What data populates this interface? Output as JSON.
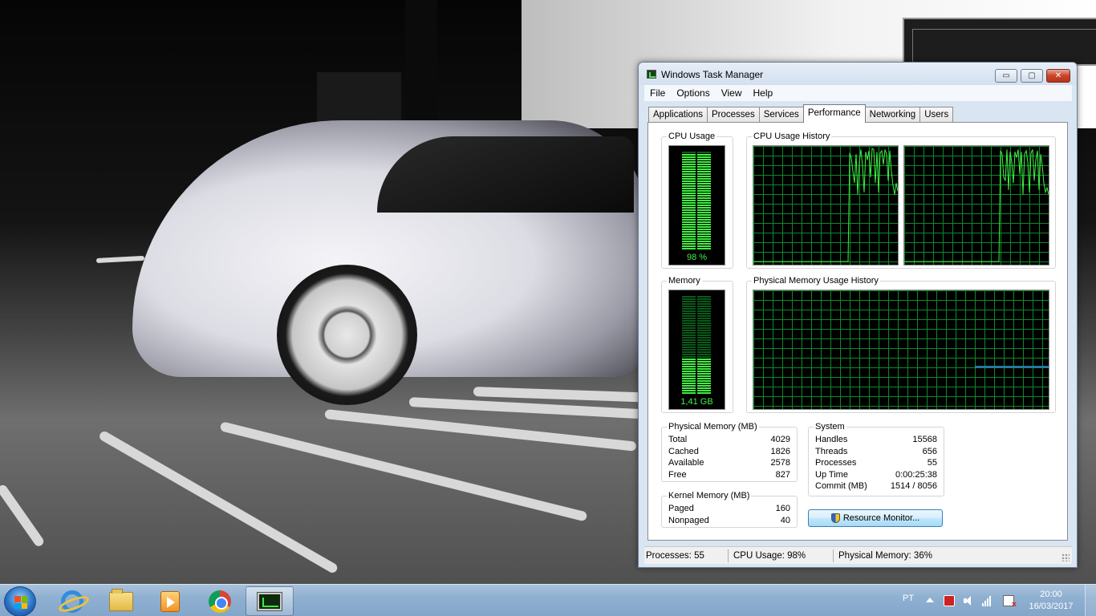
{
  "window": {
    "title": "Windows Task Manager",
    "controls": {
      "minimize": "▭",
      "maximize": "▢",
      "close": "✕"
    }
  },
  "menu": [
    "File",
    "Options",
    "View",
    "Help"
  ],
  "tabs": [
    {
      "label": "Applications",
      "active": false
    },
    {
      "label": "Processes",
      "active": false
    },
    {
      "label": "Services",
      "active": false
    },
    {
      "label": "Performance",
      "active": true
    },
    {
      "label": "Networking",
      "active": false
    },
    {
      "label": "Users",
      "active": false
    }
  ],
  "performance": {
    "cpu_usage": {
      "label": "CPU Usage",
      "value_text": "98 %",
      "percent": 98
    },
    "cpu_history": {
      "label": "CPU Usage History",
      "core1": [
        2,
        2,
        2,
        2,
        2,
        2,
        2,
        2,
        2,
        2,
        2,
        2,
        2,
        2,
        2,
        2,
        2,
        2,
        2,
        2,
        2,
        2,
        2,
        2,
        2,
        2,
        2,
        2,
        2,
        2,
        2,
        2,
        2,
        2,
        2,
        2,
        2,
        2,
        2,
        2,
        2,
        2,
        2,
        2,
        2,
        2,
        2,
        2,
        2,
        2,
        2,
        2,
        2,
        2,
        2,
        2,
        2,
        2,
        2,
        2,
        96,
        92,
        80,
        70,
        95,
        60,
        88,
        99,
        85,
        62,
        97,
        90,
        98,
        75,
        100,
        99,
        70,
        97,
        62,
        96,
        98,
        86,
        99,
        95,
        72,
        98,
        80,
        68,
        60,
        70,
        63
      ],
      "core2": [
        2,
        2,
        2,
        2,
        2,
        2,
        2,
        2,
        2,
        2,
        2,
        2,
        2,
        2,
        2,
        2,
        2,
        2,
        2,
        2,
        2,
        2,
        2,
        2,
        2,
        2,
        2,
        2,
        2,
        2,
        2,
        2,
        2,
        2,
        2,
        2,
        2,
        2,
        2,
        2,
        2,
        2,
        2,
        2,
        2,
        2,
        2,
        2,
        2,
        2,
        2,
        2,
        2,
        2,
        2,
        2,
        2,
        2,
        2,
        2,
        98,
        95,
        75,
        72,
        99,
        64,
        97,
        88,
        70,
        97,
        92,
        99,
        78,
        97,
        60,
        95,
        98,
        88,
        62,
        96,
        99,
        72,
        90,
        98,
        64,
        95,
        85,
        70,
        62,
        66,
        60
      ]
    },
    "memory": {
      "label": "Memory",
      "value_text": "1,41 GB",
      "percent": 36
    },
    "memory_history": {
      "label": "Physical Memory Usage History",
      "percent": 36
    },
    "physical_memory": {
      "label": "Physical Memory (MB)",
      "rows": [
        {
          "name": "Total",
          "value": "4029"
        },
        {
          "name": "Cached",
          "value": "1826"
        },
        {
          "name": "Available",
          "value": "2578"
        },
        {
          "name": "Free",
          "value": "827"
        }
      ]
    },
    "kernel_memory": {
      "label": "Kernel Memory (MB)",
      "rows": [
        {
          "name": "Paged",
          "value": "160"
        },
        {
          "name": "Nonpaged",
          "value": "40"
        }
      ]
    },
    "system": {
      "label": "System",
      "rows": [
        {
          "name": "Handles",
          "value": "15568"
        },
        {
          "name": "Threads",
          "value": "656"
        },
        {
          "name": "Processes",
          "value": "55"
        },
        {
          "name": "Up Time",
          "value": "0:00:25:38"
        },
        {
          "name": "Commit (MB)",
          "value": "1514 / 8056"
        }
      ]
    },
    "resource_monitor_button": "Resource Monitor..."
  },
  "statusbar": {
    "processes": "Processes: 55",
    "cpu": "CPU Usage: 98%",
    "memory": "Physical Memory: 36%"
  },
  "taskbar": {
    "apps": [
      {
        "name": "internet-explorer",
        "icon": "ie-icon",
        "active": false
      },
      {
        "name": "windows-explorer",
        "icon": "folder-icon",
        "active": false
      },
      {
        "name": "media-player",
        "icon": "media-icon",
        "active": false
      },
      {
        "name": "chrome",
        "icon": "chrome-icon",
        "active": false
      },
      {
        "name": "task-manager",
        "icon": "taskmgr-icon",
        "active": true
      }
    ],
    "language": "PT",
    "time": "20:00",
    "date": "16/03/2017"
  },
  "colors": {
    "graph_line": "#43f043",
    "memory_line": "#2f7fd6",
    "grid": "#0b8a2a"
  }
}
